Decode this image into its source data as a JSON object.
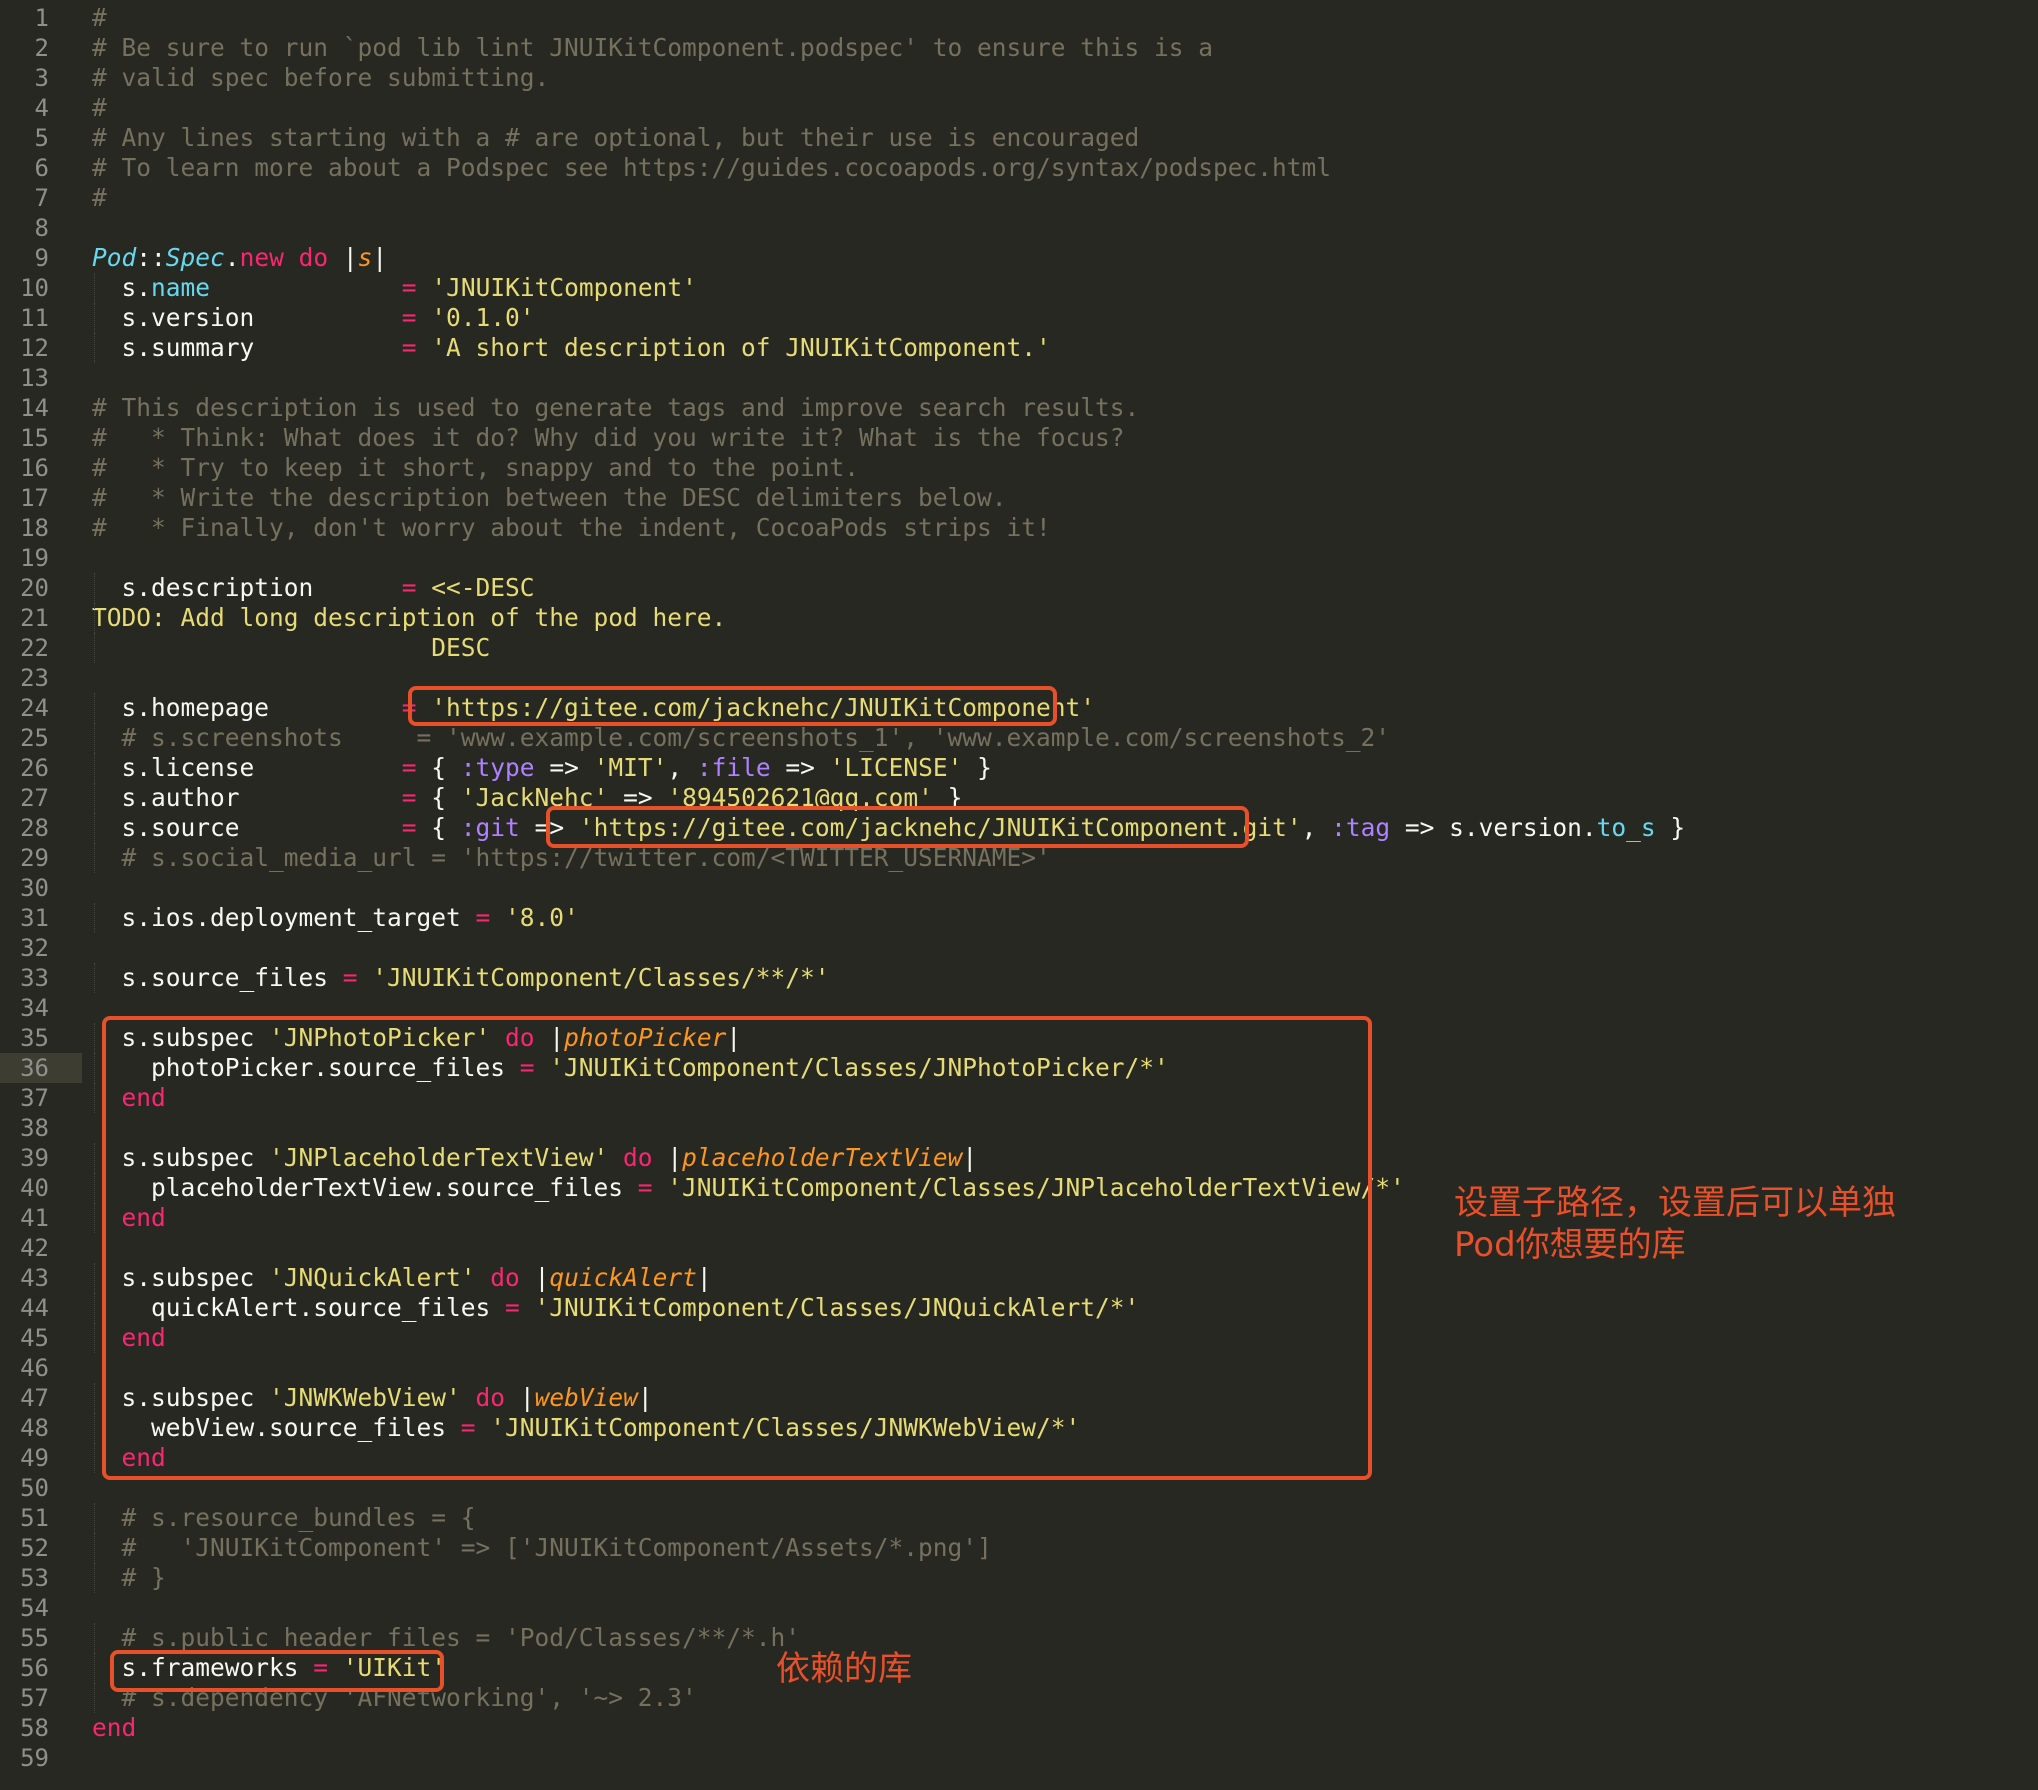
{
  "editor": {
    "active_line": 36,
    "line_count": 59,
    "theme_colors": {
      "background": "#272822",
      "comment": "#75715e",
      "keyword": "#f92672",
      "string": "#e6db74",
      "symbol": "#ae81ff",
      "class": "#66d9ef",
      "param": "#fd971f",
      "annotation": "#e8502a"
    }
  },
  "lines": [
    [
      [
        "comment",
        "#"
      ]
    ],
    [
      [
        "comment",
        "# Be sure to run `pod lib lint JNUIKitComponent.podspec' to ensure this is a"
      ]
    ],
    [
      [
        "comment",
        "# valid spec before submitting."
      ]
    ],
    [
      [
        "comment",
        "#"
      ]
    ],
    [
      [
        "comment",
        "# Any lines starting with a # are optional, but their use is encouraged"
      ]
    ],
    [
      [
        "comment",
        "# To learn more about a Podspec see https://guides.cocoapods.org/syntax/podspec.html"
      ]
    ],
    [
      [
        "comment",
        "#"
      ]
    ],
    [],
    [
      [
        "class",
        "Pod"
      ],
      [
        "plain",
        "::"
      ],
      [
        "class",
        "Spec"
      ],
      [
        "plain",
        "."
      ],
      [
        "keyword",
        "new"
      ],
      [
        "plain",
        " "
      ],
      [
        "keyword",
        "do"
      ],
      [
        "plain",
        " |"
      ],
      [
        "param",
        "s"
      ],
      [
        "plain",
        "|"
      ]
    ],
    [
      [
        "plain",
        "  s."
      ],
      [
        "method",
        "name"
      ],
      [
        "plain",
        "             "
      ],
      [
        "operator",
        "="
      ],
      [
        "plain",
        " "
      ],
      [
        "string",
        "'JNUIKitComponent'"
      ]
    ],
    [
      [
        "plain",
        "  s.version          "
      ],
      [
        "operator",
        "="
      ],
      [
        "plain",
        " "
      ],
      [
        "string",
        "'0.1.0'"
      ]
    ],
    [
      [
        "plain",
        "  s.summary          "
      ],
      [
        "operator",
        "="
      ],
      [
        "plain",
        " "
      ],
      [
        "string",
        "'A short description of JNUIKitComponent.'"
      ]
    ],
    [],
    [
      [
        "comment",
        "# This description is used to generate tags and improve search results."
      ]
    ],
    [
      [
        "comment",
        "#   * Think: What does it do? Why did you write it? What is the focus?"
      ]
    ],
    [
      [
        "comment",
        "#   * Try to keep it short, snappy and to the point."
      ]
    ],
    [
      [
        "comment",
        "#   * Write the description between the DESC delimiters below."
      ]
    ],
    [
      [
        "comment",
        "#   * Finally, don't worry about the indent, CocoaPods strips it!"
      ]
    ],
    [],
    [
      [
        "plain",
        "  s.description      "
      ],
      [
        "operator",
        "="
      ],
      [
        "plain",
        " "
      ],
      [
        "string",
        "<<-DESC"
      ]
    ],
    [
      [
        "todo",
        "TODO: Add long description of the pod here."
      ]
    ],
    [
      [
        "plain",
        "                       "
      ],
      [
        "string",
        "DESC"
      ]
    ],
    [],
    [
      [
        "plain",
        "  s.homepage         "
      ],
      [
        "operator",
        "="
      ],
      [
        "plain",
        " "
      ],
      [
        "string",
        "'https://gitee.com/jacknehc/JNUIKitComponent'"
      ]
    ],
    [
      [
        "comment",
        "  # s.screenshots     = 'www.example.com/screenshots_1', 'www.example.com/screenshots_2'"
      ]
    ],
    [
      [
        "plain",
        "  s.license          "
      ],
      [
        "operator",
        "="
      ],
      [
        "plain",
        " { "
      ],
      [
        "symbol",
        ":type"
      ],
      [
        "plain",
        " => "
      ],
      [
        "string",
        "'MIT'"
      ],
      [
        "plain",
        ", "
      ],
      [
        "symbol",
        ":file"
      ],
      [
        "plain",
        " => "
      ],
      [
        "string",
        "'LICENSE'"
      ],
      [
        "plain",
        " }"
      ]
    ],
    [
      [
        "plain",
        "  s.author           "
      ],
      [
        "operator",
        "="
      ],
      [
        "plain",
        " { "
      ],
      [
        "string",
        "'JackNehc'"
      ],
      [
        "plain",
        " => "
      ],
      [
        "string",
        "'894502621@qq.com'"
      ],
      [
        "plain",
        " }"
      ]
    ],
    [
      [
        "plain",
        "  s.source           "
      ],
      [
        "operator",
        "="
      ],
      [
        "plain",
        " { "
      ],
      [
        "symbol",
        ":git"
      ],
      [
        "plain",
        " => "
      ],
      [
        "string",
        "'https://gitee.com/jacknehc/JNUIKitComponent.git'"
      ],
      [
        "plain",
        ", "
      ],
      [
        "symbol",
        ":tag"
      ],
      [
        "plain",
        " => s.version."
      ],
      [
        "method",
        "to_s"
      ],
      [
        "plain",
        " }"
      ]
    ],
    [
      [
        "comment",
        "  # s.social_media_url = 'https://twitter.com/<TWITTER_USERNAME>'"
      ]
    ],
    [],
    [
      [
        "plain",
        "  s.ios.deployment_target "
      ],
      [
        "operator",
        "="
      ],
      [
        "plain",
        " "
      ],
      [
        "string",
        "'8.0'"
      ]
    ],
    [],
    [
      [
        "plain",
        "  s.source_files "
      ],
      [
        "operator",
        "="
      ],
      [
        "plain",
        " "
      ],
      [
        "string",
        "'JNUIKitComponent/Classes/**/*'"
      ]
    ],
    [],
    [
      [
        "plain",
        "  s.subspec "
      ],
      [
        "string",
        "'JNPhotoPicker'"
      ],
      [
        "plain",
        " "
      ],
      [
        "keyword",
        "do"
      ],
      [
        "plain",
        " |"
      ],
      [
        "param",
        "photoPicker"
      ],
      [
        "plain",
        "|"
      ]
    ],
    [
      [
        "plain",
        "    photoPicker.source_files "
      ],
      [
        "operator",
        "="
      ],
      [
        "plain",
        " "
      ],
      [
        "string",
        "'JNUIKitComponent/Classes/JNPhotoPicker/*'"
      ]
    ],
    [
      [
        "plain",
        "  "
      ],
      [
        "keyword",
        "end"
      ]
    ],
    [],
    [
      [
        "plain",
        "  s.subspec "
      ],
      [
        "string",
        "'JNPlaceholderTextView'"
      ],
      [
        "plain",
        " "
      ],
      [
        "keyword",
        "do"
      ],
      [
        "plain",
        " |"
      ],
      [
        "param",
        "placeholderTextView"
      ],
      [
        "plain",
        "|"
      ]
    ],
    [
      [
        "plain",
        "    placeholderTextView.source_files "
      ],
      [
        "operator",
        "="
      ],
      [
        "plain",
        " "
      ],
      [
        "string",
        "'JNUIKitComponent/Classes/JNPlaceholderTextView/*'"
      ]
    ],
    [
      [
        "plain",
        "  "
      ],
      [
        "keyword",
        "end"
      ]
    ],
    [],
    [
      [
        "plain",
        "  s.subspec "
      ],
      [
        "string",
        "'JNQuickAlert'"
      ],
      [
        "plain",
        " "
      ],
      [
        "keyword",
        "do"
      ],
      [
        "plain",
        " |"
      ],
      [
        "param",
        "quickAlert"
      ],
      [
        "plain",
        "|"
      ]
    ],
    [
      [
        "plain",
        "    quickAlert.source_files "
      ],
      [
        "operator",
        "="
      ],
      [
        "plain",
        " "
      ],
      [
        "string",
        "'JNUIKitComponent/Classes/JNQuickAlert/*'"
      ]
    ],
    [
      [
        "plain",
        "  "
      ],
      [
        "keyword",
        "end"
      ]
    ],
    [],
    [
      [
        "plain",
        "  s.subspec "
      ],
      [
        "string",
        "'JNWKWebView'"
      ],
      [
        "plain",
        " "
      ],
      [
        "keyword",
        "do"
      ],
      [
        "plain",
        " |"
      ],
      [
        "param",
        "webView"
      ],
      [
        "plain",
        "|"
      ]
    ],
    [
      [
        "plain",
        "    webView.source_files "
      ],
      [
        "operator",
        "="
      ],
      [
        "plain",
        " "
      ],
      [
        "string",
        "'JNUIKitComponent/Classes/JNWKWebView/*'"
      ]
    ],
    [
      [
        "plain",
        "  "
      ],
      [
        "keyword",
        "end"
      ]
    ],
    [],
    [
      [
        "comment",
        "  # s.resource_bundles = {"
      ]
    ],
    [
      [
        "comment",
        "  #   'JNUIKitComponent' => ['JNUIKitComponent/Assets/*.png']"
      ]
    ],
    [
      [
        "comment",
        "  # }"
      ]
    ],
    [],
    [
      [
        "comment",
        "  # s.public_header_files = 'Pod/Classes/**/*.h'"
      ]
    ],
    [
      [
        "plain",
        "  s.frameworks "
      ],
      [
        "operator",
        "="
      ],
      [
        "plain",
        " "
      ],
      [
        "string",
        "'UIKit'"
      ]
    ],
    [
      [
        "comment",
        "  # s.dependency 'AFNetworking', '~> 2.3'"
      ]
    ],
    [
      [
        "keyword",
        "end"
      ]
    ],
    []
  ],
  "annotations": {
    "subspec_note": "设置子路径，设置后可以单独\nPod你想要的库",
    "frameworks_note": "依赖的库"
  }
}
